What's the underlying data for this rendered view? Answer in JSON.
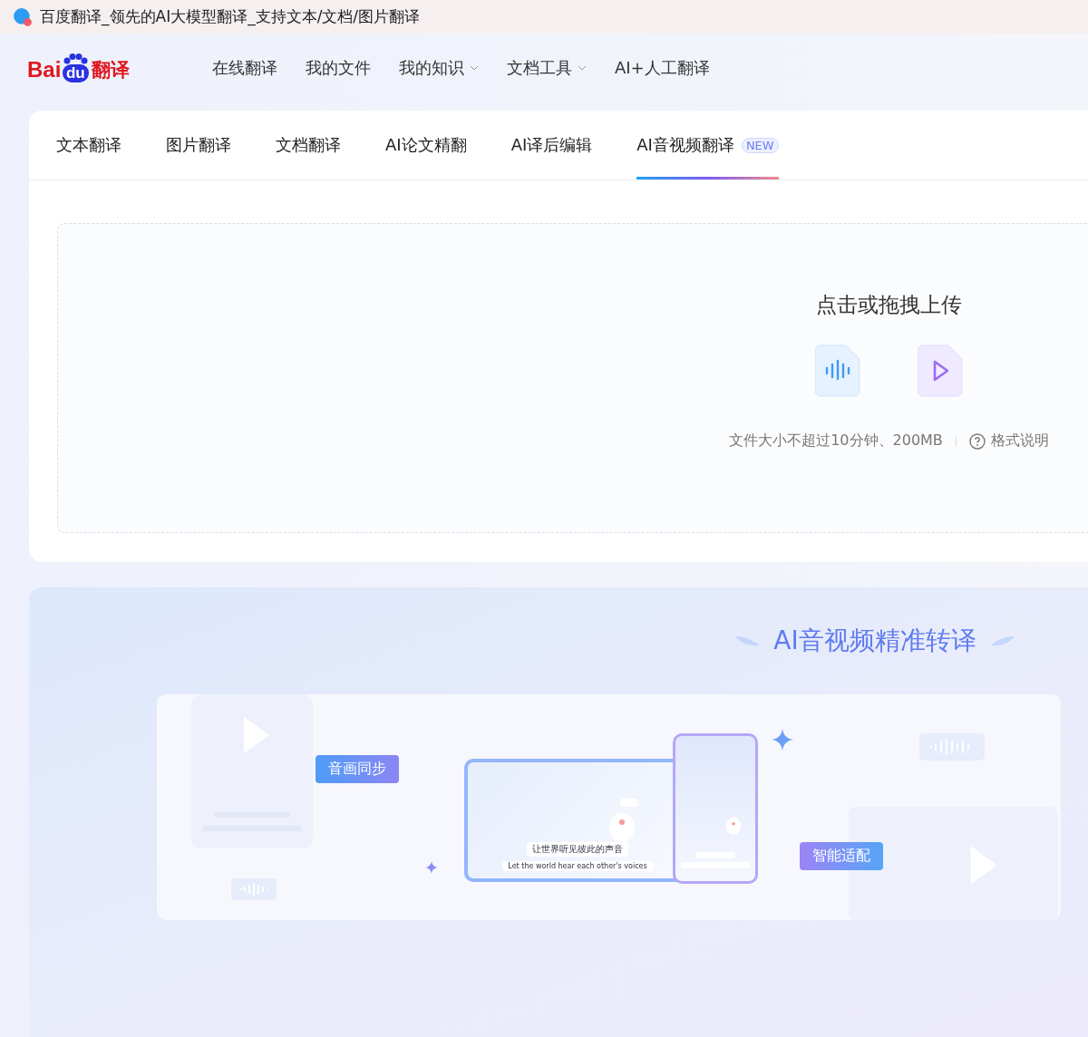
{
  "window": {
    "title": "百度翻译_领先的AI大模型翻译_支持文本/文档/图片翻译"
  },
  "logo": {
    "brand": "Bai",
    "paw": "du",
    "product": "翻译"
  },
  "nav": [
    {
      "label": "在线翻译",
      "has_menu": false
    },
    {
      "label": "我的文件",
      "has_menu": false
    },
    {
      "label": "我的知识",
      "has_menu": true
    },
    {
      "label": "文档工具",
      "has_menu": true
    },
    {
      "label": "AI+人工翻译",
      "has_menu": false
    }
  ],
  "tabs": [
    {
      "label": "文本翻译",
      "selected": false
    },
    {
      "label": "图片翻译",
      "selected": false
    },
    {
      "label": "文档翻译",
      "selected": false
    },
    {
      "label": "AI论文精翻",
      "selected": false
    },
    {
      "label": "AI译后编辑",
      "selected": false
    },
    {
      "label": "AI音视频翻译",
      "selected": true,
      "badge": "NEW"
    }
  ],
  "upload": {
    "title": "点击或拖拽上传",
    "limit": "文件大小不超过10分钟、200MB",
    "help": "格式说明"
  },
  "promo": {
    "heading": "AI音视频精准转译",
    "tags": [
      "音画同步",
      "智能适配"
    ],
    "caption_zh": "让世界听见彼此的声音",
    "caption_en": "Let the world hear each other's voices"
  }
}
